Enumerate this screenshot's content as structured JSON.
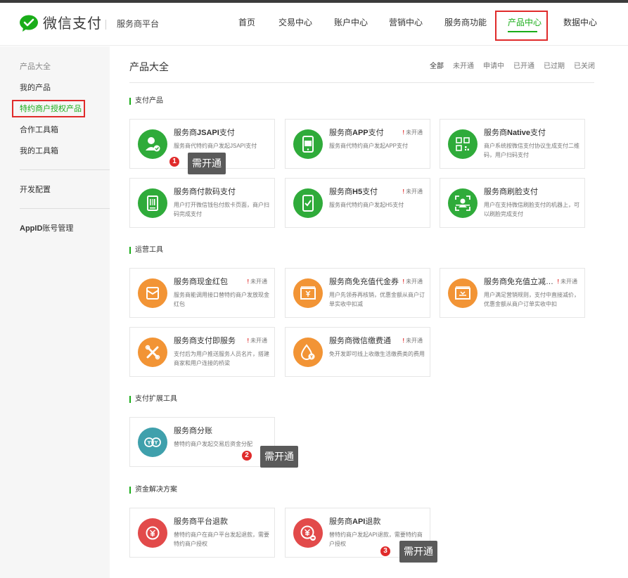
{
  "header": {
    "logo_text": "微信支付",
    "platform": "服务商平台",
    "nav": [
      {
        "label": "首页"
      },
      {
        "label": "交易中心"
      },
      {
        "label": "账户中心"
      },
      {
        "label": "营销中心"
      },
      {
        "label": "服务商功能"
      },
      {
        "label": "产品中心",
        "active": true
      },
      {
        "label": "数据中心"
      }
    ]
  },
  "sidebar": {
    "items": [
      {
        "label": "产品大全"
      },
      {
        "label": "我的产品"
      },
      {
        "label": "特约商户授权产品"
      },
      {
        "label": "合作工具箱"
      },
      {
        "label": "我的工具箱"
      },
      {
        "label": "开发配置"
      },
      {
        "label": "账号管理",
        "prefix": "AppID"
      }
    ]
  },
  "main": {
    "title": "产品大全",
    "filters": [
      "全部",
      "未开通",
      "申请中",
      "已开通",
      "已过期",
      "已关闭"
    ],
    "sections": [
      {
        "title": "支付产品",
        "cards": [
          {
            "title": "服务商JSAPI支付",
            "desc": "服务商代特约商户发起JSAPI支付",
            "status": "",
            "icon": "user-pay-icon",
            "color": "green"
          },
          {
            "title": "服务商APP支付",
            "desc": "服务商代特约商户发起APP支付",
            "status": "未开通",
            "icon": "app-pay-icon",
            "color": "green"
          },
          {
            "title": "服务商Native支付",
            "desc": "商户系统按微信支付协议生成支付二维码，用户扫码支付",
            "status": "",
            "icon": "qrcode-icon",
            "color": "green"
          },
          {
            "title": "服务商付款码支付",
            "desc": "用户打开微信钱包付款卡页面，商户扫码完成支付",
            "status": "",
            "icon": "barcode-scanner-icon",
            "color": "green"
          },
          {
            "title": "服务商H5支付",
            "desc": "服务商代特约商户发起H5支付",
            "status": "未开通",
            "icon": "mobile-pay-icon",
            "color": "green"
          },
          {
            "title": "服务商刷脸支付",
            "desc": "用户在支持微信刷脸支付的机器上，可以刷脸完成支付",
            "status": "",
            "icon": "face-pay-icon",
            "color": "green"
          }
        ]
      },
      {
        "title": "运营工具",
        "cards": [
          {
            "title": "服务商现金红包",
            "desc": "服务商能调用接口替特约商户发放现金红包",
            "status": "未开通",
            "icon": "red-packet-icon",
            "color": "orange"
          },
          {
            "title": "服务商免充值代金券",
            "desc": "用户先领券再核销，优惠金额从商户订单实收中扣减",
            "status": "未开通",
            "icon": "coupon-icon",
            "color": "orange"
          },
          {
            "title": "服务商免充值立减与折扣",
            "desc": "用户满足营销规则，支付中直接减价，优惠金额从商户订单实收中扣",
            "status": "未开通",
            "icon": "discount-icon",
            "color": "orange"
          },
          {
            "title": "服务商支付即服务",
            "desc": "支付后为用户推送服务人员名片，搭建商家和用户连接的桥梁",
            "status": "未开通",
            "icon": "service-link-icon",
            "color": "orange"
          },
          {
            "title": "服务商微信缴费通",
            "desc": "免开发即可线上收缴生活缴费类的费用",
            "status": "未开通",
            "icon": "utility-bill-icon",
            "color": "orange"
          }
        ]
      },
      {
        "title": "支付扩展工具",
        "cards": [
          {
            "title": "服务商分账",
            "desc": "替特约商户发起交易后资金分配",
            "status": "",
            "icon": "profit-sharing-icon",
            "color": "teal"
          }
        ]
      },
      {
        "title": "资金解决方案",
        "cards": [
          {
            "title": "服务商平台退款",
            "desc": "替特约商户在商户平台发起退款，需要特约商户授权",
            "status": "",
            "icon": "refund-icon",
            "color": "red"
          },
          {
            "title": "服务商API退款",
            "desc": "替特约商户发起API退款，需要特约商户授权",
            "status": "",
            "icon": "api-refund-icon",
            "color": "red"
          }
        ]
      }
    ]
  },
  "annotations": [
    {
      "number": "1",
      "text": "需开通"
    },
    {
      "number": "2",
      "text": "需开通"
    },
    {
      "number": "3",
      "text": "需开通"
    }
  ]
}
